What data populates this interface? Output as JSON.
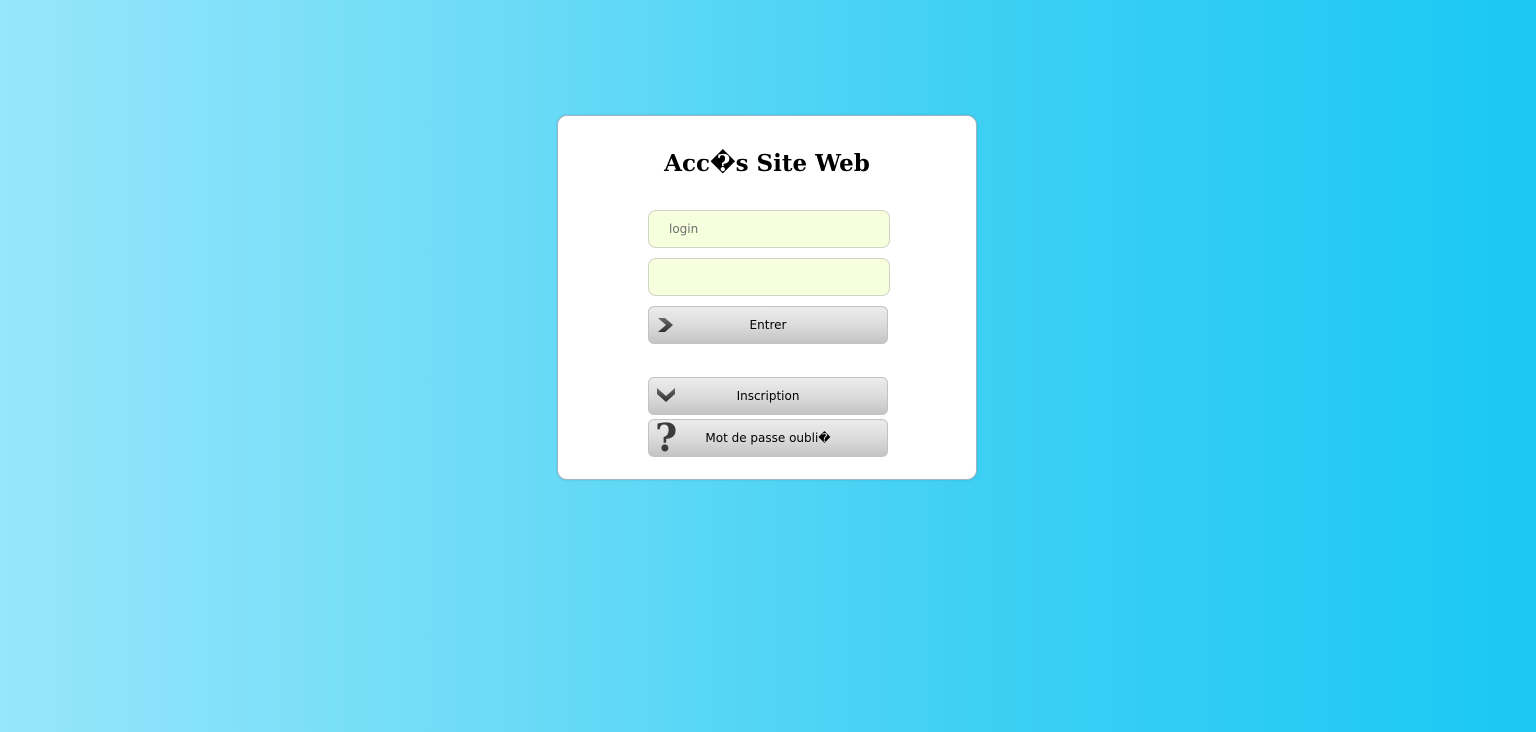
{
  "form": {
    "title": "Acc�s Site Web",
    "login_placeholder": "login",
    "login_value": "",
    "password_placeholder": "",
    "password_value": ""
  },
  "buttons": {
    "enter_label": "Entrer",
    "enter_icon": "chevron-right-icon",
    "signup_label": "Inscription",
    "signup_icon": "chevron-down-icon",
    "forgot_label": "Mot de passe oubli�",
    "forgot_icon": "question-mark-icon"
  },
  "colors": {
    "background_start": "#97e6fb",
    "background_end": "#1ac8f3",
    "input_background": "#f6fedd",
    "card_background": "#ffffff"
  }
}
